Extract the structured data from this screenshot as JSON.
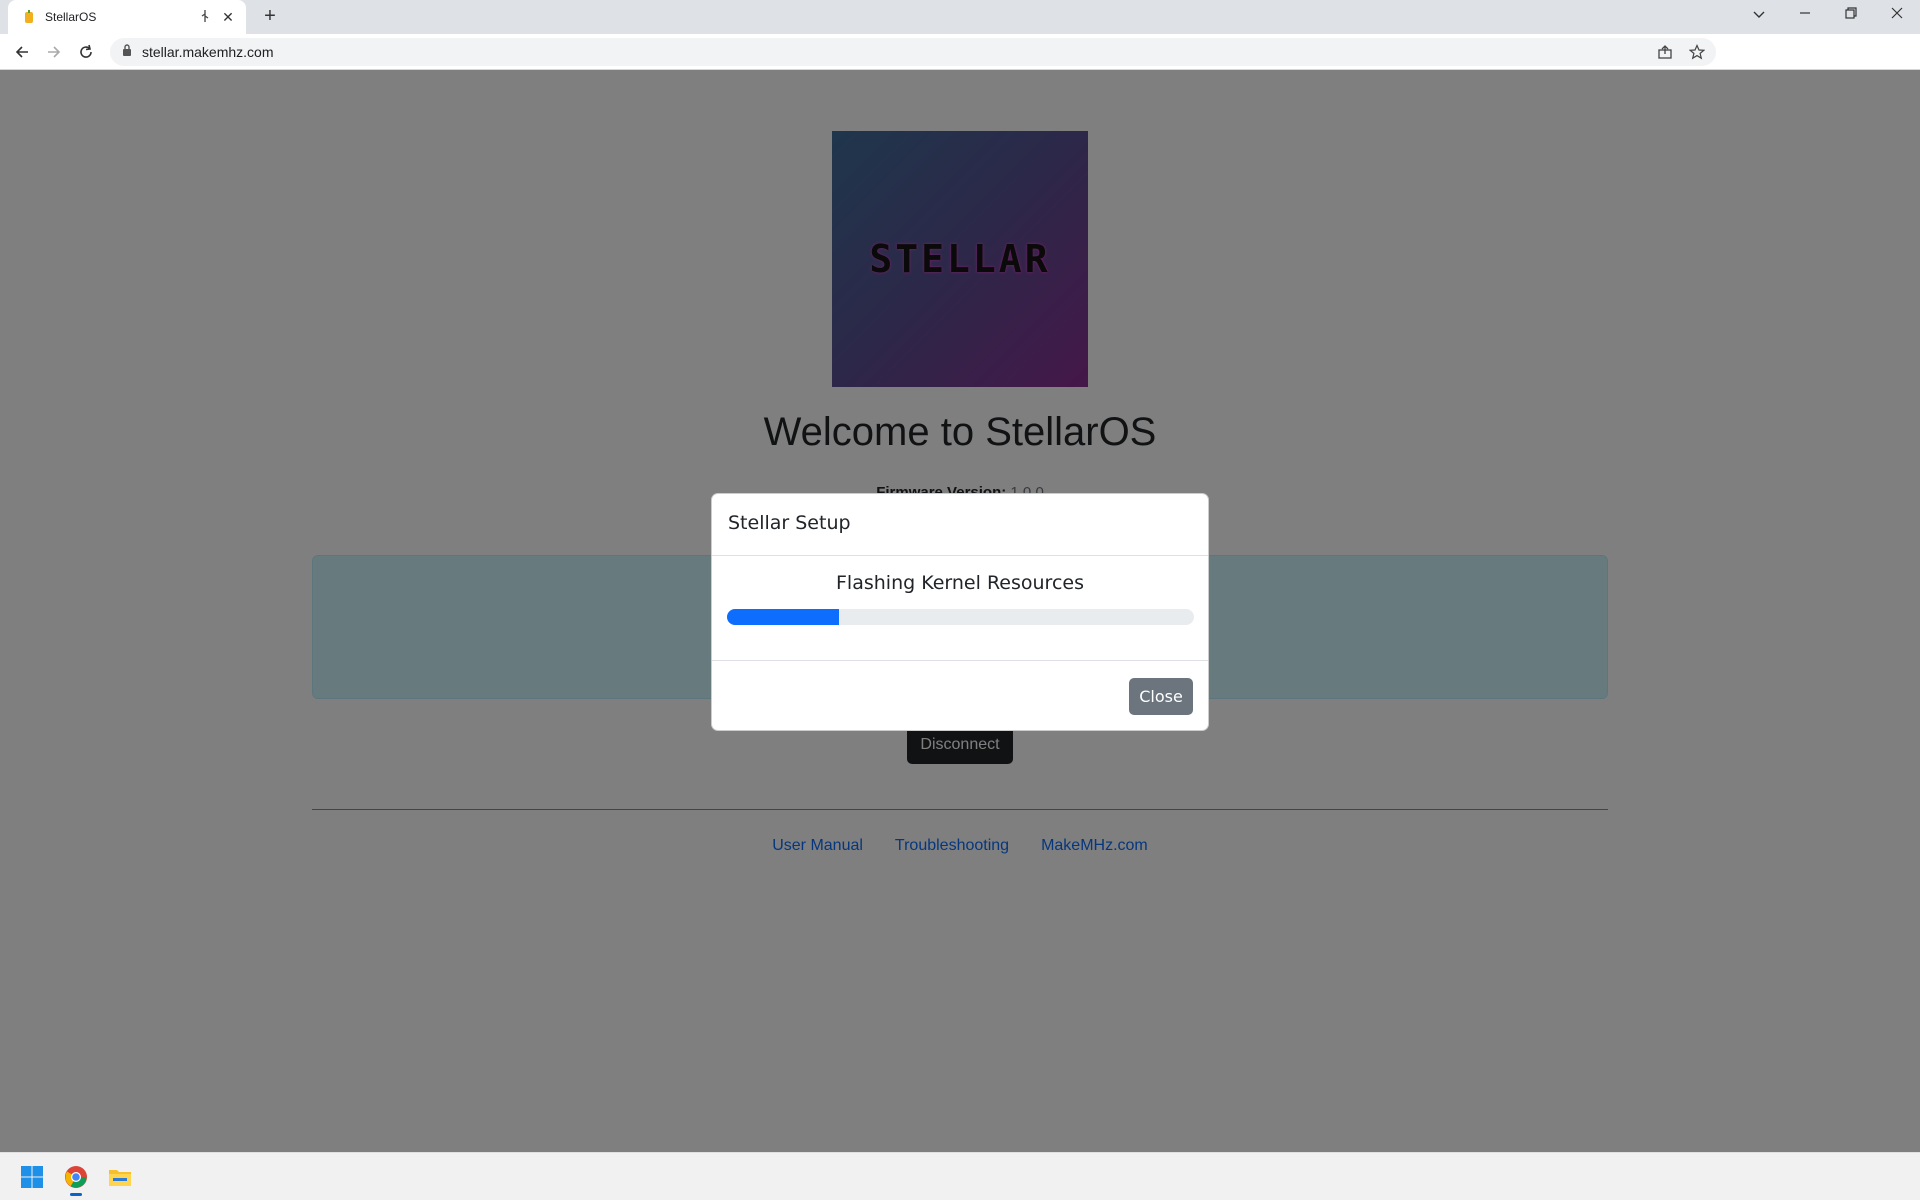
{
  "browser": {
    "tab_title": "StellarOS",
    "new_tab_label": "+",
    "url": "stellar.makemhz.com"
  },
  "page": {
    "logo_text": "STELLAR",
    "welcome": "Welcome to StellarOS",
    "firmware_label": "Firmware Version:",
    "firmware_value": "1.0.0",
    "disconnect_label": "Disconnect",
    "links": [
      "User Manual",
      "Troubleshooting",
      "MakeMHz.com"
    ]
  },
  "modal": {
    "title": "Stellar Setup",
    "message": "Flashing Kernel Resources",
    "progress_percent": 24,
    "close_label": "Close"
  },
  "colors": {
    "progress_fill": "#0d6efd",
    "close_button": "#6c757d",
    "link": "#0d6efd"
  }
}
